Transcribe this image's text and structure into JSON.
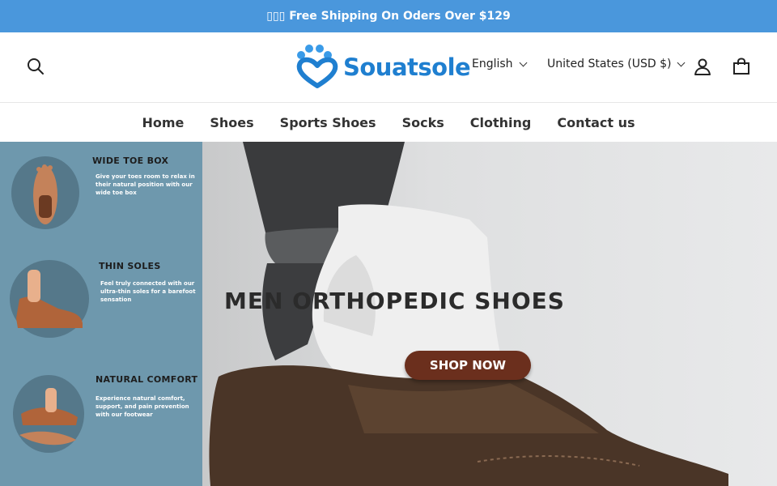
{
  "announcement": {
    "text": "▯▯▯ Free Shipping On Oders Over $129"
  },
  "header": {
    "logo_text": "Souatsole",
    "language": "English",
    "currency": "United States (USD $)",
    "icons": {
      "search": "search-icon",
      "account": "user-icon",
      "cart": "bag-icon"
    }
  },
  "nav": {
    "items": [
      {
        "label": "Home"
      },
      {
        "label": "Shoes"
      },
      {
        "label": "Sports Shoes"
      },
      {
        "label": "Socks"
      },
      {
        "label": "Clothing"
      },
      {
        "label": "Contact us"
      }
    ]
  },
  "hero": {
    "features": [
      {
        "title": "WIDE TOE BOX",
        "desc": "Give your toes room to relax in their natural position with our wide toe box"
      },
      {
        "title": "THIN SOLES",
        "desc": "Feel truly connected with our ultra-thin soles for a barefoot sensation"
      },
      {
        "title": "NATURAL COMFORT",
        "desc": "Experience natural comfort, support, and pain prevention with our footwear"
      }
    ],
    "headline": "MEN ORTHOPEDIC SHOES",
    "cta": "SHOP NOW"
  },
  "colors": {
    "announce_bg": "#4a97dc",
    "panel_bg": "#6e98ad",
    "cta_bg": "#6b2f1d",
    "logo": "#1f7fd0"
  }
}
